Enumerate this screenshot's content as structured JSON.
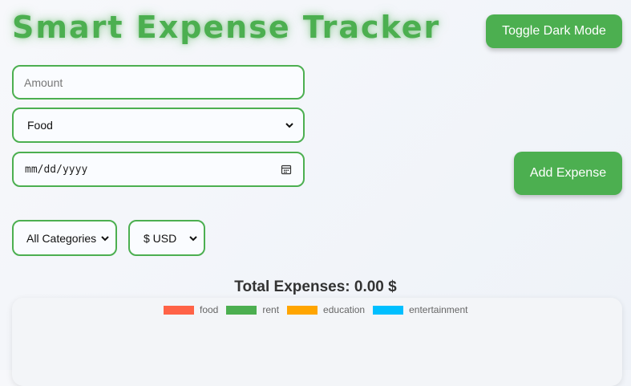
{
  "header": {
    "title": "Smart Expense Tracker",
    "toggle_label": "Toggle Dark Mode"
  },
  "form": {
    "amount_placeholder": "Amount",
    "category_selected": "Food",
    "date_placeholder": "mm/dd/yyyy",
    "add_label": "Add Expense"
  },
  "filters": {
    "category_selected": "All Categories",
    "currency_selected": "$ USD"
  },
  "summary": {
    "total_text": "Total Expenses: 0.00 $"
  },
  "chart": {
    "legend": [
      {
        "label": "food",
        "color": "#ff6347"
      },
      {
        "label": "rent",
        "color": "#4caf50"
      },
      {
        "label": "education",
        "color": "#ffa500"
      },
      {
        "label": "entertainment",
        "color": "#00bfff"
      }
    ]
  },
  "colors": {
    "accent": "#4caf50"
  }
}
